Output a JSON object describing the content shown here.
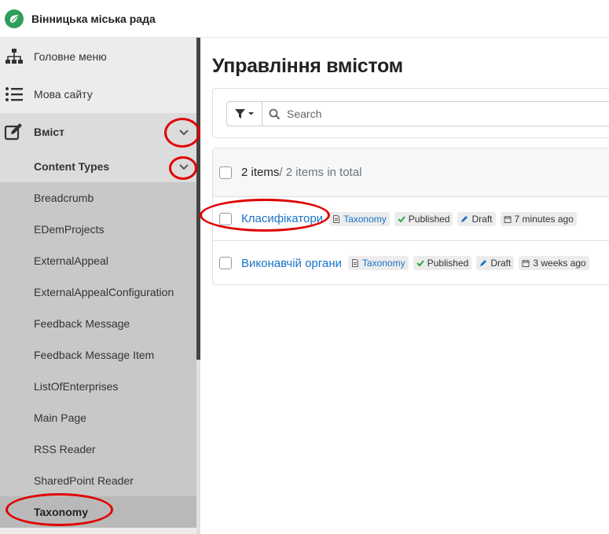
{
  "header": {
    "title": "Вінницька міська рада"
  },
  "sidebar": {
    "items": [
      {
        "label": "Головне меню",
        "icon": "sitemap-icon"
      },
      {
        "label": "Мова сайту",
        "icon": "list-icon"
      },
      {
        "label": "Вміст",
        "icon": "edit-icon"
      }
    ],
    "submenu_label": "Content Types",
    "types": [
      "Breadcrumb",
      "EDemProjects",
      "ExternalAppeal",
      "ExternalAppealConfiguration",
      "Feedback Message",
      "Feedback Message Item",
      "ListOfEnterprises",
      "Main Page",
      "RSS Reader",
      "SharedPoint Reader",
      "Taxonomy"
    ],
    "active_type": "Taxonomy"
  },
  "main": {
    "title": "Управління вмістом",
    "search": {
      "placeholder": "Search"
    },
    "list": {
      "count_label": "2 items",
      "total_label": " / 2 items in total",
      "rows": [
        {
          "title": "Класифікатори",
          "type": "Taxonomy",
          "status": "Published",
          "draft": "Draft",
          "time": "7 minutes ago"
        },
        {
          "title": "Виконавчій органи",
          "type": "Taxonomy",
          "status": "Published",
          "draft": "Draft",
          "time": "3 weeks ago"
        }
      ]
    }
  },
  "colors": {
    "accent": "#1a73c8",
    "published": "#28a745",
    "brand": "#2e9e5b",
    "annotation": "#e00000"
  }
}
